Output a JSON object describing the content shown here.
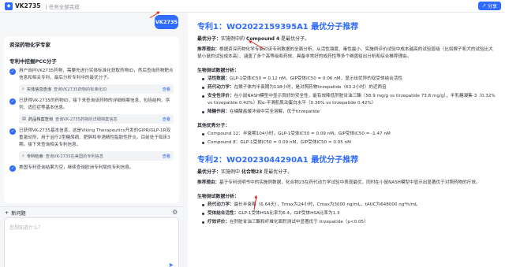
{
  "header": {
    "app_name": "VK2735",
    "breadcrumb": "任务全部完成",
    "share_label": "分享"
  },
  "chat": {
    "user_message": "VK2735",
    "agent_title": "资深药物化学专家",
    "section_title": "专利中挖掘PCC分子",
    "steps": [
      {
        "text": "用户询问VK2735药物，需要先进行实体标准化获取药物ID，然后查询药物靶点信息和相关专利，最后分析专利中的最优分子。",
        "tool": {
          "tag": "实体信息查询",
          "query": "查询VK2735药物的标准化ID",
          "action": "查看"
        }
      },
      {
        "text": "已获得VK-2735的药物ID，接下来查询该药物的详细档案信息，包括结构、序列、适应症等基本信息。",
        "tool": {
          "tag": "药品档案查询",
          "query": "查询VK-2735药物的详细档案信息",
          "action": "查看"
        }
      },
      {
        "text": "已获得VK-2735基本信息，这是Viking Therapeutics开发的GIPR/GLP-1R双重激动剂，用于治疗2型糖尿病、肥胖和非酒精性脂肪性肝炎。目前处于临床3期。接下来查询相关专利信息。",
        "tool": {
          "tag": "专利检索",
          "query": "查询VK-2735在美国的专利信息",
          "action": "查看"
        }
      },
      {
        "text": "美国专利查询结果为空，继续查询欧洲专利局的专利信息。",
        "tool": null
      }
    ],
    "new_question_label": "新问题",
    "input_placeholder": "您想知道什么？"
  },
  "patents": [
    {
      "title": "专利1：WO2022159395A1 最优分子推荐",
      "optimal_label": "最优分子：",
      "optimal_text": "实施例中的 ",
      "optimal_compound": "Compound 4",
      "optimal_suffix": " 是最优分子。",
      "reason_label": "推荐理由：",
      "reason_text": "根据资深药物化学专家对该专利数据的全面分析，从活性强度、毒性最小、实施例评价试验中成本越高的试验层级（比如猴子和犬的试验比大鼠小鼠的试验成本高）、涵盖了多个高等级和药效、具备非常好的成药性等多个维度给出分析和综合推荐理由。",
      "bio_heading": "生物测试数据分析：",
      "bio_items": [
        {
          "label": "活性数据：",
          "text": "GLP-1受体IC50 = 0.12 nM，GIP受体IC50 = 0.06 nM，显示出优异的双受体结合活性"
        },
        {
          "label": "药代动力学：",
          "text": "在猴子体内半衰期为118小时，是对照药物tirzepatide（63.2小时）的近两倍"
        },
        {
          "label": "安全性评价：",
          "text": "在小鼠NASH模型中显示良好的安全性，能有效降低肝脏甘油三酯（58.9 mg/g vs tirzepatide 73.8 mg/g），半乳糖凝集-3（0.32% vs tirzepatide 0.42%）和α-平滑肌肌动蛋白水平（0.36% vs tirzepatide 0.42%）"
        },
        {
          "label": "降糖作用：",
          "text": "在磷酸盐缓冲液中完全溶解，优于tirzepatide"
        }
      ],
      "other_heading": "其他优秀分子：",
      "other_items": [
        {
          "text": "Compound 12：半衰期104小时，GLP-1受体IC50 = 0.09 nM，GIP受体IC50 = -1.47 nM"
        },
        {
          "text": "Compound 8：GLP-1受体IC50 = 0.09 nM，GIP受体IC50 = 0.05 nM"
        }
      ]
    },
    {
      "title": "专利2：WO2023044290A1 最优分子推荐",
      "optimal_label": "最优分子：",
      "optimal_text": "实施例中 ",
      "optimal_compound": "化合物23",
      "optimal_suffix": " 是最优分子。",
      "reason_label": "推荐理由：",
      "reason_text": "基于专利说明书中的实施例数据，化合物23在药代动力学试验中表现最优，同时在小鼠NASH模型中显示出显著优于对照药物的疗效。",
      "bio_heading": "生物测试数据分析：",
      "bio_items": [
        {
          "label": "药代动力学：",
          "text": "最长半衰期（6.64天），Tmax为24小时，Cmax为3000 ng/mL，tAUC为648000 ng*h/mL"
        },
        {
          "label": "受体结合活性：",
          "text": "GLP-1受体HSA比率为6.4，GIP受体HSA比率为1.3"
        },
        {
          "label": "疗效评价：",
          "text": "在肝脏甘油三酯和纤维化面积测试中显著优于 tirzepatide（p<0.05）"
        }
      ]
    }
  ]
}
